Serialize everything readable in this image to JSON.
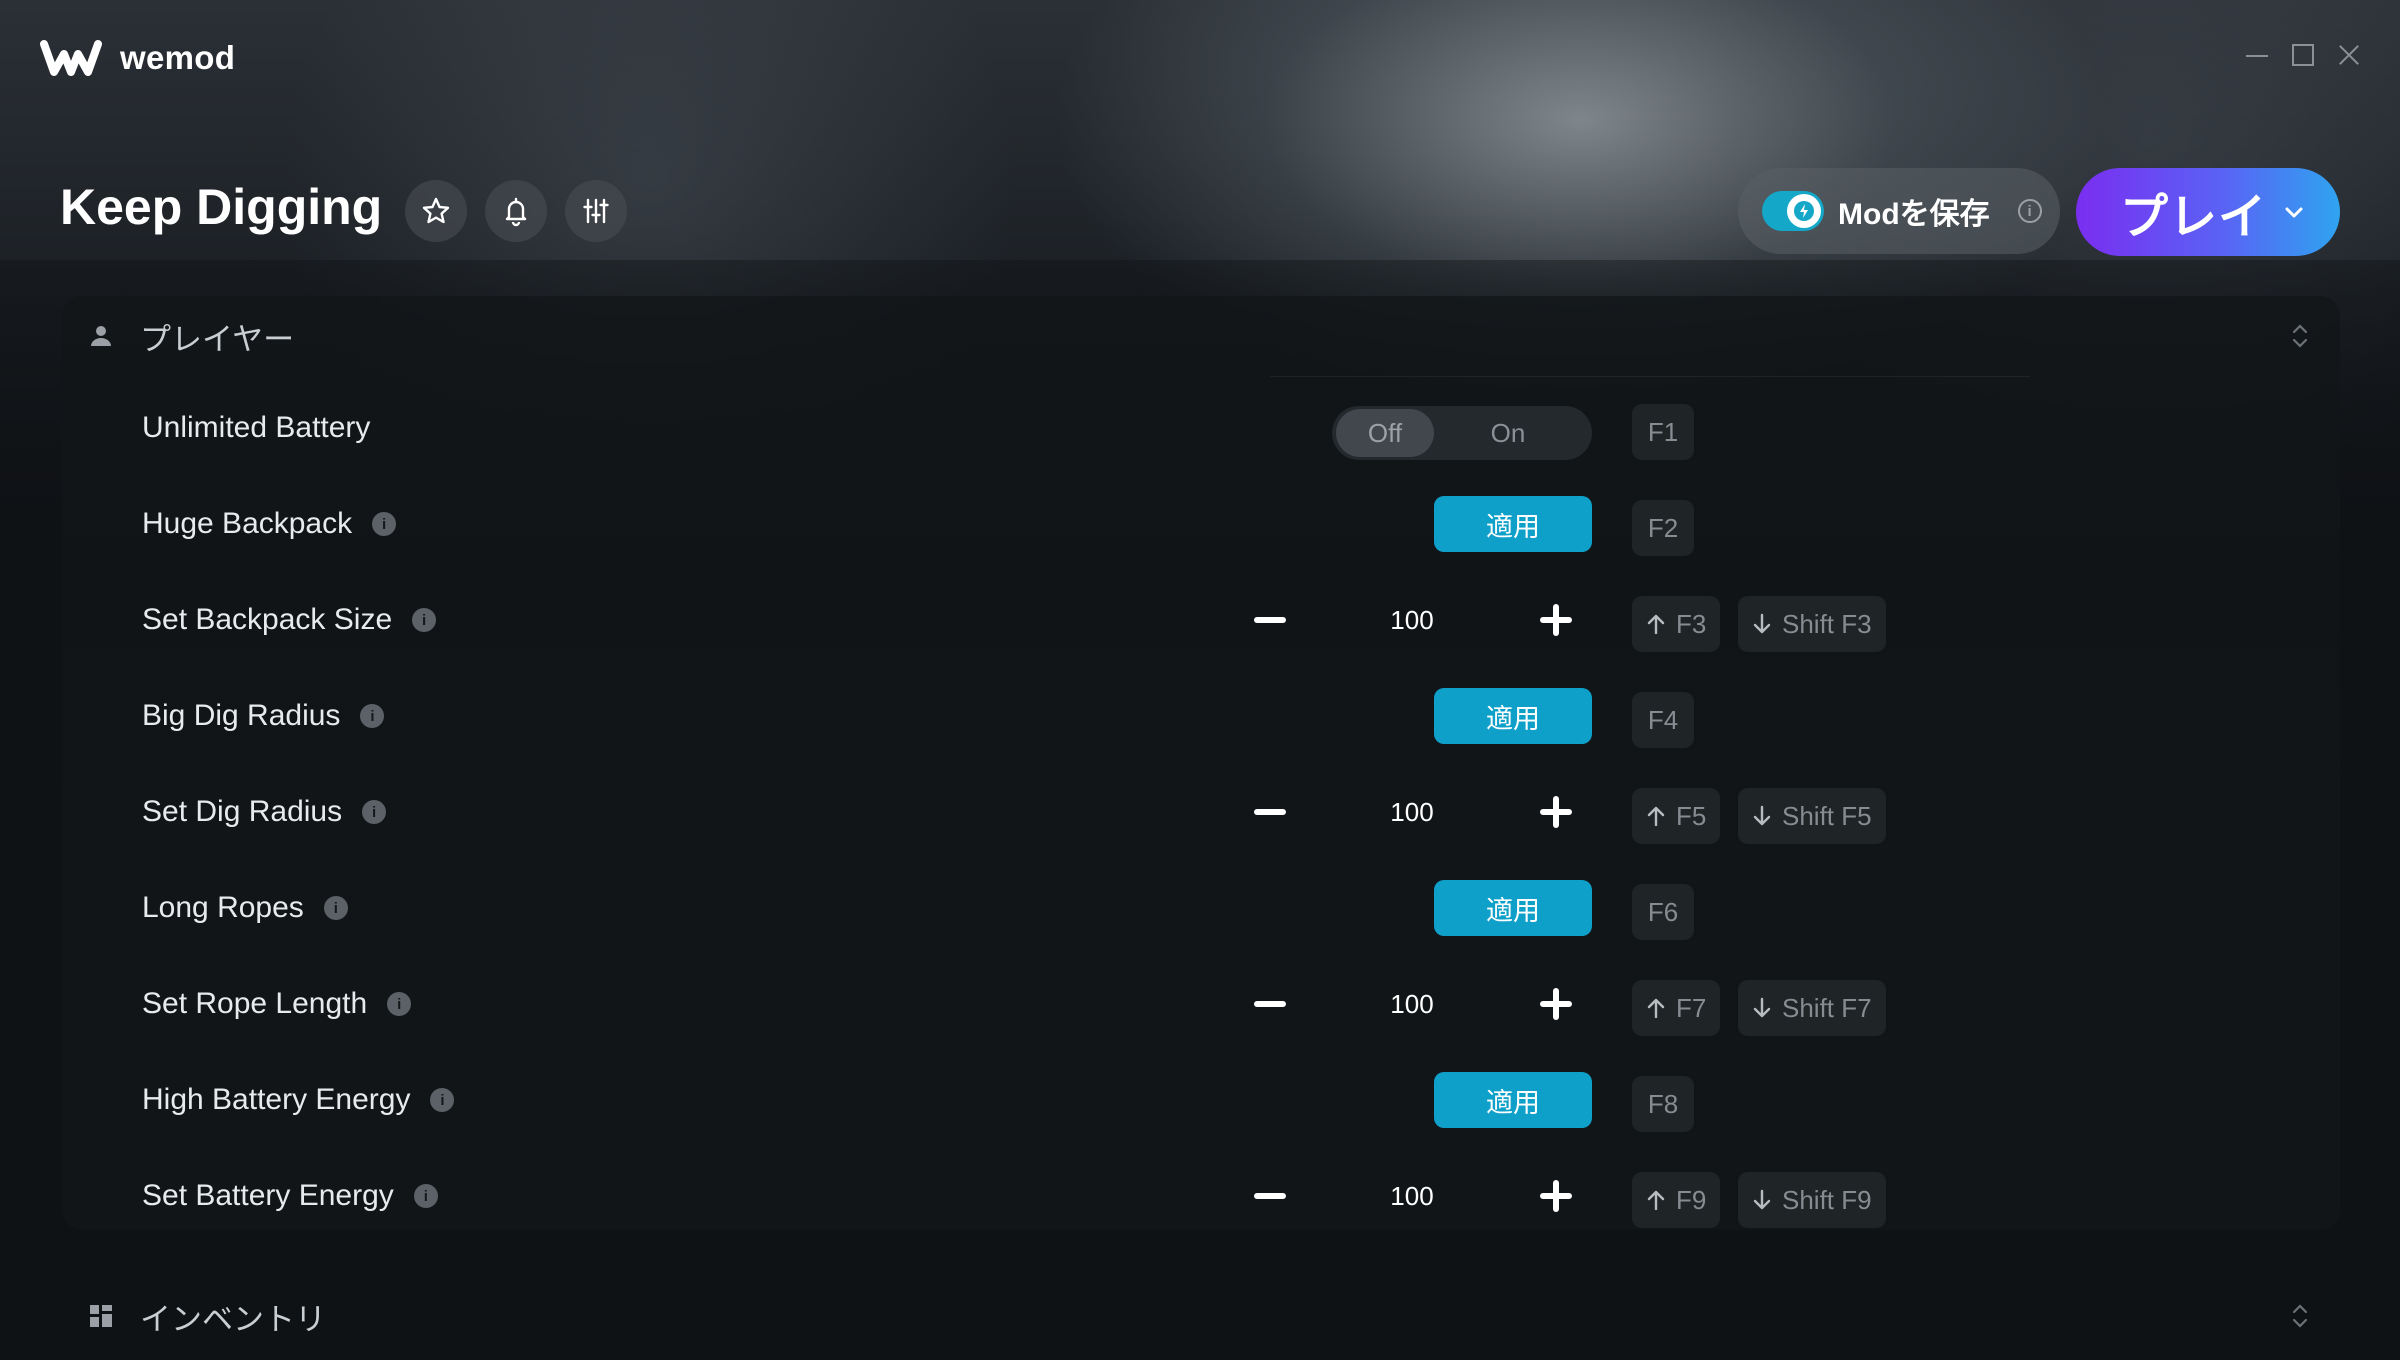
{
  "app": {
    "name": "wemod"
  },
  "game": {
    "title": "Keep Digging"
  },
  "header": {
    "save_mods_label": "Modを保存",
    "save_mods_info": "i",
    "play_label": "プレイ"
  },
  "sections": [
    {
      "label": "プレイヤー"
    },
    {
      "label": "インベントリ"
    }
  ],
  "toggle": {
    "off": "Off",
    "on": "On"
  },
  "apply_label": "適用",
  "info_glyph": "i",
  "mods": [
    {
      "name": "Unlimited Battery",
      "type": "toggle",
      "state": "Off",
      "hotkey": "F1"
    },
    {
      "name": "Huge Backpack",
      "type": "apply",
      "hotkey": "F2"
    },
    {
      "name": "Set Backpack Size",
      "type": "stepper",
      "value": "100",
      "hotkey_up": "F3",
      "hotkey_down": "Shift F3"
    },
    {
      "name": "Big Dig Radius",
      "type": "apply",
      "hotkey": "F4"
    },
    {
      "name": "Set Dig Radius",
      "type": "stepper",
      "value": "100",
      "hotkey_up": "F5",
      "hotkey_down": "Shift F5"
    },
    {
      "name": "Long Ropes",
      "type": "apply",
      "hotkey": "F6"
    },
    {
      "name": "Set Rope Length",
      "type": "stepper",
      "value": "100",
      "hotkey_up": "F7",
      "hotkey_down": "Shift F7"
    },
    {
      "name": "High Battery Energy",
      "type": "apply",
      "hotkey": "F8"
    },
    {
      "name": "Set Battery Energy",
      "type": "stepper",
      "value": "100",
      "hotkey_up": "F9",
      "hotkey_down": "Shift F9"
    }
  ],
  "colors": {
    "accent": "#0ea0c8",
    "play_gradient_start": "#7a2ef0",
    "play_gradient_end": "#2fa4f0",
    "save_toggle": "#15a7c8"
  }
}
